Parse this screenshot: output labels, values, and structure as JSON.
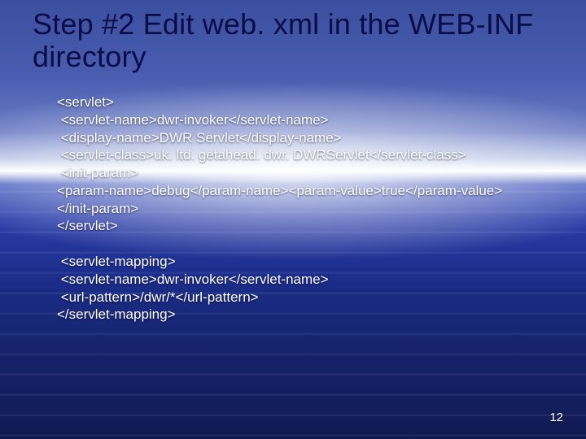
{
  "title": "Step #2 Edit web. xml in the WEB-INF directory",
  "block1": {
    "l1": "<servlet>",
    "l2": " <servlet-name>dwr-invoker</servlet-name>",
    "l3": " <display-name>DWR Servlet</display-name>",
    "l4": " <servlet-class>uk. ltd. getahead. dwr. DWRServlet</servlet-class>",
    "l5": " <init-param>",
    "l6": "<param-name>debug</param-name><param-value>true</param-value>",
    "l7": "</init-param>",
    "l8": "</servlet>"
  },
  "block2": {
    "l1": " <servlet-mapping>",
    "l2": " <servlet-name>dwr-invoker</servlet-name>",
    "l3": " <url-pattern>/dwr/*</url-pattern>",
    "l4": "</servlet-mapping>"
  },
  "page_number": "12"
}
